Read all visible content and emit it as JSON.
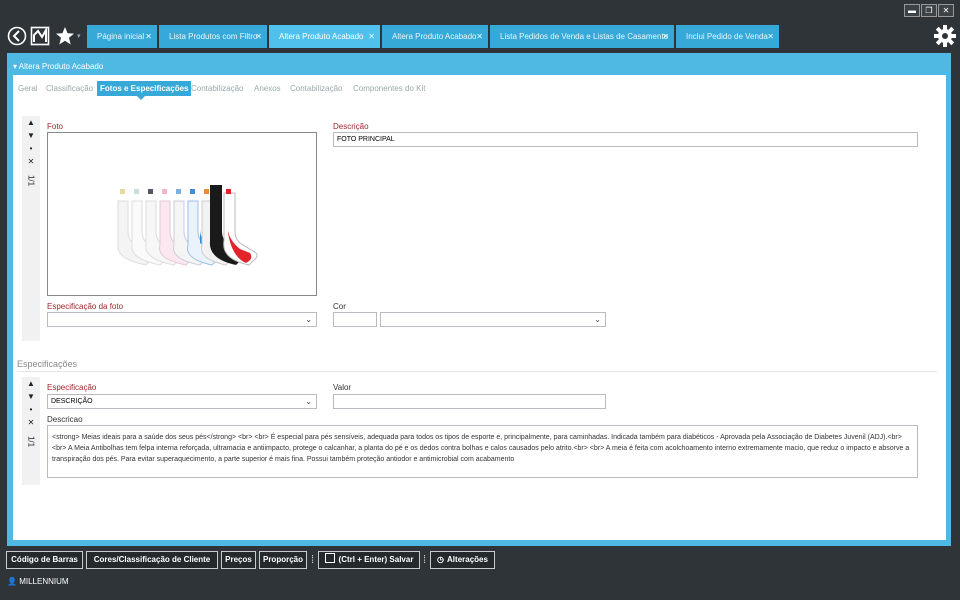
{
  "window": {
    "minimize": "▬",
    "restore": "❐",
    "close": "✕"
  },
  "tabs": [
    {
      "label": "Página inicial"
    },
    {
      "label": "Lista Produtos com Filtro"
    },
    {
      "label": "Altera Produto Acabado"
    },
    {
      "label": "Altera Produto Acabado"
    },
    {
      "label": "Lista Pedidos de Venda e Listas de Casamento"
    },
    {
      "label": "Inclui Pedido de Venda"
    }
  ],
  "tab_close": "✕",
  "panel": {
    "title": "Altera Produto Acabado",
    "subtabs": [
      "Geral",
      "Classificação",
      "Fotos e Especificações",
      "Contabilização",
      "Anexos",
      "Contabilização",
      "Componentes do Kit"
    ]
  },
  "photo": {
    "foto_label": "Foto",
    "descricao_label": "Descrição",
    "descricao_value": "FOTO PRINCIPAL",
    "especificacao_foto_label": "Especificação da foto",
    "cor_label": "Cor",
    "pager": "1/1"
  },
  "specs": {
    "section_title": "Especificações",
    "especificacao_label": "Especificação",
    "especificacao_value": "DESCRIÇÃO",
    "valor_label": "Valor",
    "descricao_label": "Descricao",
    "descricao_text": "<strong> Meias ideais para a saúde dos seus pés</strong> <br>  <br>  É especial para pés sensíveis, adequada para todos os tipos de esporte e, principalmente, para caminhadas. Indicada também para diabéticos - Aprovada pela Associação de Diabetes Juvenil (ADJ).<br>  <br>  A Meia Antibolhas tem felpa interna reforçada, ultramacia e antiimpacto, protege o calcanhar, a planta do pé e os dedos contra bolhas e calos causados pelo atrito.<br>  <br>  A meia é feita com acolchoamento interno extremamente macio, que reduz o impacto e absorve a transpiração dos pés. Para evitar superaquecimento, a parte superior é mais fina. Possui também proteção antiodor e antimicrobial com acabamento",
    "pager": "1/1"
  },
  "bottom_buttons": [
    {
      "label": "Código de Barras"
    },
    {
      "label": "Cores/Classificação de Cliente"
    },
    {
      "label": "Preços"
    },
    {
      "label": "Proporção"
    },
    {
      "label": "(Ctrl + Enter) Salvar"
    },
    {
      "label": "Alterações"
    }
  ],
  "status": {
    "user": "MILLENNIUM"
  },
  "colors": {
    "accent": "#37a9d8",
    "active_tab": "#4fc1ec",
    "label_red": "#a1262b",
    "dark": "#2f3438"
  }
}
